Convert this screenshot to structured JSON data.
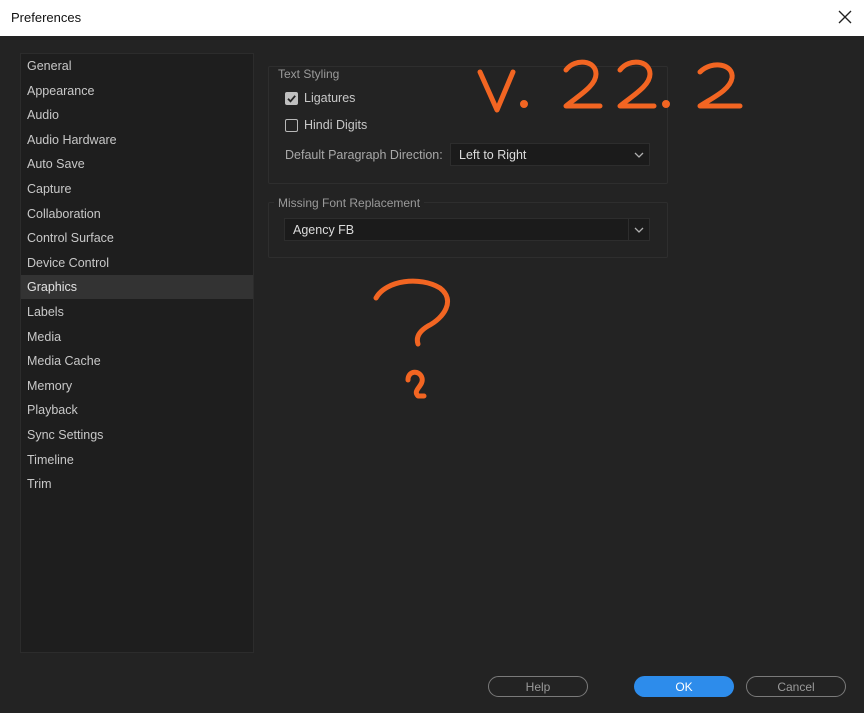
{
  "window": {
    "title": "Preferences",
    "close_icon": "close-icon"
  },
  "sidebar": {
    "items": [
      {
        "label": "General"
      },
      {
        "label": "Appearance"
      },
      {
        "label": "Audio"
      },
      {
        "label": "Audio Hardware"
      },
      {
        "label": "Auto Save"
      },
      {
        "label": "Capture"
      },
      {
        "label": "Collaboration"
      },
      {
        "label": "Control Surface"
      },
      {
        "label": "Device Control"
      },
      {
        "label": "Graphics",
        "selected": true
      },
      {
        "label": "Labels"
      },
      {
        "label": "Media"
      },
      {
        "label": "Media Cache"
      },
      {
        "label": "Memory"
      },
      {
        "label": "Playback"
      },
      {
        "label": "Sync Settings"
      },
      {
        "label": "Timeline"
      },
      {
        "label": "Trim"
      }
    ]
  },
  "text_styling": {
    "label": "Text Styling",
    "ligatures": {
      "label": "Ligatures",
      "checked": true
    },
    "hindi_digits": {
      "label": "Hindi Digits",
      "checked": false
    },
    "paragraph_direction": {
      "label": "Default Paragraph Direction:",
      "value": "Left to Right"
    }
  },
  "missing_font": {
    "label": "Missing Font Replacement",
    "value": "Agency FB"
  },
  "buttons": {
    "help": "Help",
    "ok": "OK",
    "cancel": "Cancel"
  },
  "annotations": {
    "color": "#f26522",
    "version_text": "V. 22.2",
    "mark": "?"
  },
  "colors": {
    "dialog_bg": "#232323",
    "accent": "#2d8ceb"
  }
}
